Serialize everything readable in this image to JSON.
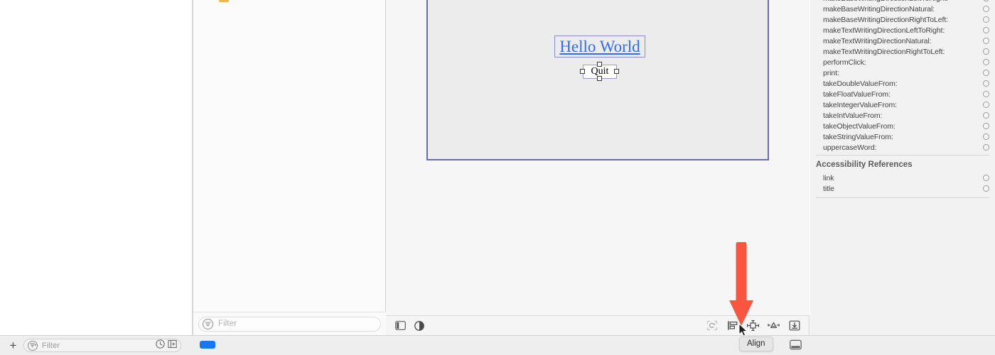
{
  "library_panel": {
    "filter": {
      "placeholder": "Filter",
      "value": ""
    }
  },
  "canvas": {
    "link_label": "Hello World",
    "button_label": "Quit",
    "link_color": "#2f6df2",
    "window_border_color": "#6b6ba6",
    "toolbar": {
      "left_buttons": [
        {
          "name": "show-hide-sidebar",
          "label": "Show/Hide Sidebar"
        },
        {
          "name": "appearance-toggle",
          "label": "Appearance"
        }
      ],
      "right_buttons": [
        {
          "name": "update-frames",
          "label": "Update Frames"
        },
        {
          "name": "align",
          "label": "Align"
        },
        {
          "name": "add-constraints",
          "label": "Add New Constraints"
        },
        {
          "name": "resolve-auto-layout-issues",
          "label": "Resolve Auto Layout Issues"
        },
        {
          "name": "embed-in",
          "label": "Embed In"
        }
      ]
    }
  },
  "inspector": {
    "attributes": [
      "makeBaseWritingDirectionLeftToRight:",
      "makeBaseWritingDirectionNatural:",
      "makeBaseWritingDirectionRightToLeft:",
      "makeTextWritingDirectionLeftToRight:",
      "makeTextWritingDirectionNatural:",
      "makeTextWritingDirectionRightToLeft:",
      "performClick:",
      "print:",
      "takeDoubleValueFrom:",
      "takeFloatValueFrom:",
      "takeIntegerValueFrom:",
      "takeIntValueFrom:",
      "takeObjectValueFrom:",
      "takeStringValueFrom:",
      "uppercaseWord:"
    ],
    "references_title": "Accessibility References",
    "references": [
      "link",
      "title"
    ]
  },
  "status_bar": {
    "add_label": "+",
    "filter": {
      "placeholder": "Filter",
      "value": ""
    }
  },
  "tooltip": {
    "text": "Align"
  },
  "annotation": {
    "arrow_color": "#f9553f",
    "points_to": "align-button"
  }
}
